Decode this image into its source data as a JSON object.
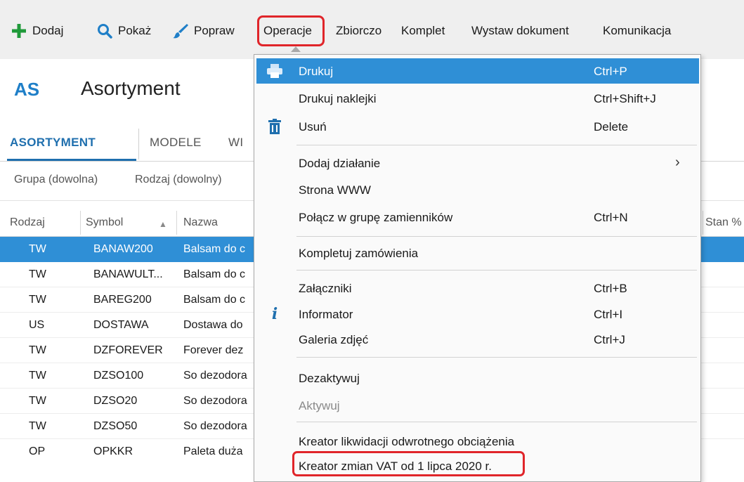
{
  "toolbar": {
    "items": [
      {
        "label": "Dodaj",
        "icon": "plus-icon"
      },
      {
        "label": "Pokaż",
        "icon": "search-icon"
      },
      {
        "label": "Popraw",
        "icon": "brush-icon"
      },
      {
        "label": "Operacje"
      },
      {
        "label": "Zbiorczo"
      },
      {
        "label": "Komplet"
      },
      {
        "label": "Wystaw dokument"
      },
      {
        "label": "Komunikacja"
      }
    ]
  },
  "header": {
    "badge": "AS",
    "title": "Asortyment"
  },
  "tabs": [
    {
      "label": "ASORTYMENT",
      "active": true
    },
    {
      "label": "MODELE"
    },
    {
      "label": "WI"
    }
  ],
  "filters": [
    "Grupa (dowolna)",
    "Rodzaj (dowolny)"
  ],
  "table": {
    "columns": [
      "Rodzaj",
      "Symbol",
      "Nazwa",
      "Stan %"
    ],
    "rows": [
      {
        "kind": "TW",
        "symbol": "BANAW200",
        "name": "Balsam do c",
        "selected": true
      },
      {
        "kind": "TW",
        "symbol": "BANAWULT...",
        "name": "Balsam do c"
      },
      {
        "kind": "TW",
        "symbol": "BAREG200",
        "name": "Balsam do c"
      },
      {
        "kind": "US",
        "symbol": "DOSTAWA",
        "name": "Dostawa do"
      },
      {
        "kind": "TW",
        "symbol": "DZFOREVER",
        "name": "Forever dez"
      },
      {
        "kind": "TW",
        "symbol": "DZSO100",
        "name": "So dezodora"
      },
      {
        "kind": "TW",
        "symbol": "DZSO20",
        "name": "So dezodora"
      },
      {
        "kind": "TW",
        "symbol": "DZSO50",
        "name": "So dezodora"
      },
      {
        "kind": "OP",
        "symbol": "OPKKR",
        "name": "Paleta duża"
      }
    ]
  },
  "menu": {
    "items": [
      {
        "label": "Drukuj",
        "shortcut": "Ctrl+P",
        "icon": "printer-icon",
        "highlighted": true
      },
      {
        "label": "Drukuj naklejki",
        "shortcut": "Ctrl+Shift+J"
      },
      {
        "label": "Usuń",
        "shortcut": "Delete",
        "icon": "trash-icon"
      },
      {
        "label": "Dodaj działanie",
        "submenu_arrow": "›"
      },
      {
        "label": "Strona WWW"
      },
      {
        "label": "Połącz w grupę zamienników",
        "shortcut": "Ctrl+N"
      },
      {
        "label": "Kompletuj zamówienia"
      },
      {
        "label": "Załączniki",
        "shortcut": "Ctrl+B"
      },
      {
        "label": "Informator",
        "shortcut": "Ctrl+I",
        "icon": "info-icon"
      },
      {
        "label": "Galeria zdjęć",
        "shortcut": "Ctrl+J"
      },
      {
        "label": "Dezaktywuj"
      },
      {
        "label": "Aktywuj",
        "disabled": true
      },
      {
        "label": "Kreator likwidacji odwrotnego obciążenia"
      },
      {
        "label": "Kreator zmian VAT od 1 lipca 2020 r."
      }
    ]
  },
  "colors": {
    "accent": "#2f8fd6",
    "brand": "#1f7fc8",
    "callout": "#e0252a",
    "plus": "#1f9a3a"
  }
}
